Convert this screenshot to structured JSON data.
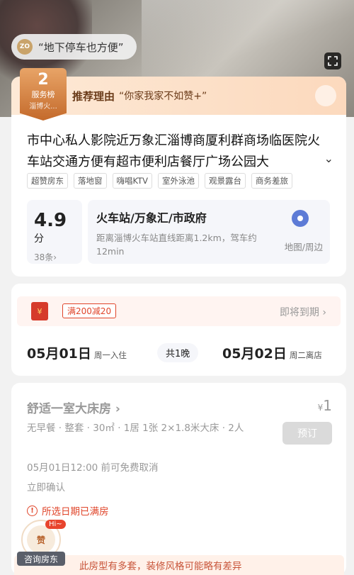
{
  "hero": {
    "pill_icon_text": "ZO",
    "pill_text": "“地下停车也方便”"
  },
  "rank": {
    "number": "2",
    "name": "服务榜",
    "sub": "淄博火..."
  },
  "reason": {
    "label": "推荐理由",
    "quote": "“你家我家不如赞+”"
  },
  "hotel": {
    "title": "市中心私人影院近万象汇淄博商厦利群商场临医院火车站交通方便有超市便利店餐厅广场公园大",
    "tags": [
      "超赞房东",
      "落地窗",
      "嗨唱KTV",
      "室外泳池",
      "观景露台",
      "商务差旅"
    ]
  },
  "score": {
    "value": "4.9",
    "unit": "分",
    "count": "38条›"
  },
  "location": {
    "name": "火车站/万象汇/市政府",
    "distance": "距离淄博火车站直线距离1.2km，驾车约12min",
    "map_label": "地图/周边"
  },
  "promo": {
    "icon_text": "¥",
    "tag": "满200减20",
    "right": "即将到期 ›"
  },
  "dates": {
    "checkin": "05月01日",
    "checkin_sub": "周一入住",
    "nights": "共1晚",
    "checkout": "05月02日",
    "checkout_sub": "周二离店"
  },
  "room": {
    "name": "舒适一室大床房 ›",
    "price_symbol": "¥",
    "price": "1",
    "desc": "无早餐 · 整套 · 30㎡ · 1居 1张 2×1.8米大床 · 2人",
    "book": "预订",
    "cancel": "05月01日12:00 前可免费取消",
    "confirm": "立即确认",
    "full": "所选日期已满房"
  },
  "notice": {
    "text": "此房型有多套，装修风格可能略有差异"
  },
  "host": {
    "avatar_text": "赞",
    "hi": "Hi~",
    "label": "咨询房东"
  },
  "colors": {
    "accent": "#e0452a",
    "brand_orange": "#c46a2b",
    "map_blue": "#5d7bd6"
  }
}
